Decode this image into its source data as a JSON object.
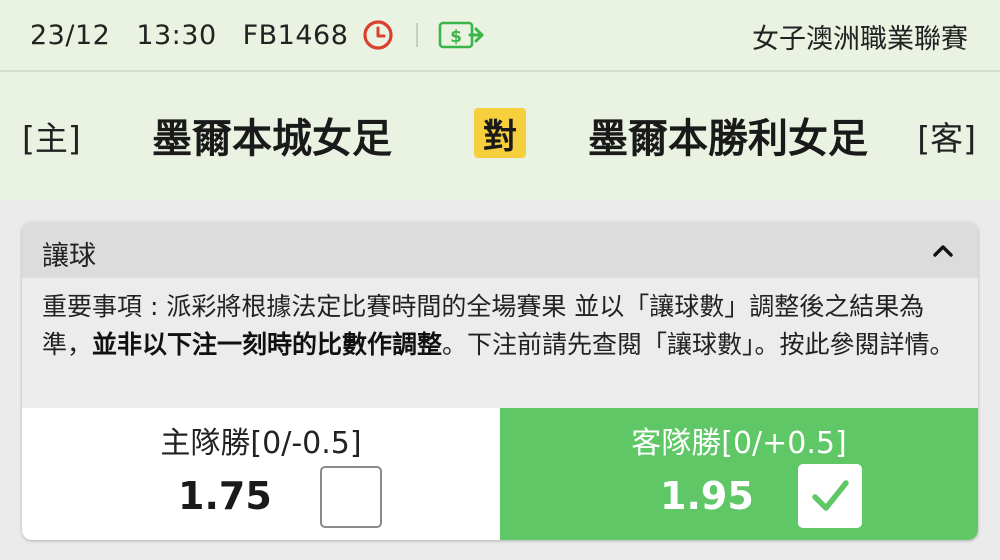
{
  "header": {
    "date": "23/12",
    "time": "13:30",
    "match_id": "FB1468",
    "league": "女子澳洲職業聯賽",
    "clock_icon": "clock-icon",
    "cash_icon": "cash-out-icon"
  },
  "match": {
    "home_tag": "[主]",
    "home_team": "墨爾本城女足",
    "vs": "對",
    "away_team": "墨爾本勝利女足",
    "away_tag": "[客]"
  },
  "bet_card": {
    "title": "讓球",
    "chevron": "chevron-up-icon",
    "notice_part1": "重要事項 : 派彩將根據法定比賽時間的全場賽果 並以「讓球數」調整後之結果為準，",
    "notice_bold": "並非以下注一刻時的比數作調整",
    "notice_part2": "。下注前請先查閱「讓球數」。按此參閱詳情。",
    "options": [
      {
        "label": "主隊勝[0/-0.5]",
        "odds": "1.75",
        "selected": false
      },
      {
        "label": "客隊勝[0/+0.5]",
        "odds": "1.95",
        "selected": true
      }
    ]
  },
  "colors": {
    "header_bg": "#eaf2e2",
    "vs_badge": "#f6cf3c",
    "selected_green": "#5fc766",
    "clock_red": "#d9412e",
    "cash_green": "#3ab54a"
  }
}
